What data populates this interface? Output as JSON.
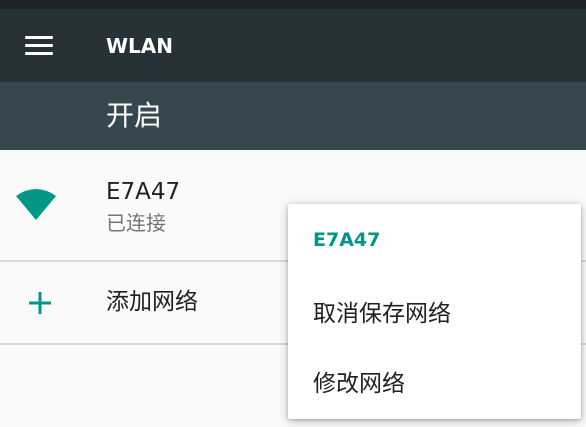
{
  "toolbar": {
    "title": "WLAN",
    "menu_icon": "hamburger-menu-icon"
  },
  "master_switch": {
    "label": "开启"
  },
  "networks": [
    {
      "name": "E7A47",
      "status": "已连接",
      "icon": "wifi-signal-icon"
    }
  ],
  "add_network": {
    "label": "添加网络",
    "icon": "plus-icon"
  },
  "context_menu": {
    "title": "E7A47",
    "items": [
      {
        "label": "取消保存网络"
      },
      {
        "label": "修改网络"
      }
    ]
  },
  "colors": {
    "toolbar": "#263238",
    "switch_bar": "#37474f",
    "status_bar": "#1e2427",
    "accent": "#009688",
    "background": "#fafafa"
  }
}
